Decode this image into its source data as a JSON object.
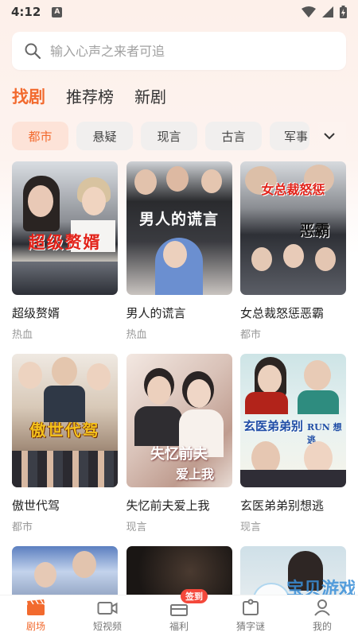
{
  "status_bar": {
    "time": "4:12",
    "sim_letter": "A"
  },
  "search": {
    "placeholder": "输入心声之来者可追"
  },
  "tabs": [
    {
      "label": "找剧",
      "active": true
    },
    {
      "label": "推荐榜",
      "active": false
    },
    {
      "label": "新剧",
      "active": false
    }
  ],
  "chips": [
    "都市",
    "悬疑",
    "现言",
    "古言",
    "军事"
  ],
  "chip_cut": "军事",
  "cards": [
    {
      "title": "超级赘婿",
      "tag": "热血",
      "poster_text": "超级赘婿"
    },
    {
      "title": "男人的谎言",
      "tag": "热血",
      "poster_text": "男人的谎言"
    },
    {
      "title": "女总裁怒惩恶霸",
      "tag": "都市",
      "poster_text": "女总裁怒惩",
      "poster_text2": "恶霸"
    },
    {
      "title": "傲世代驾",
      "tag": "都市",
      "poster_text": "傲世代驾"
    },
    {
      "title": "失忆前夫爱上我",
      "tag": "现言",
      "poster_text": "失忆前夫",
      "poster_text2": "爱上我"
    },
    {
      "title": "玄医弟弟别想逃",
      "tag": "现言",
      "poster_text": "玄医弟弟别",
      "poster_text2": "RUN 想逃"
    }
  ],
  "bottom_nav": [
    {
      "label": "剧场",
      "icon": "clapperboard-icon",
      "active": true
    },
    {
      "label": "短视频",
      "icon": "video-camera-icon",
      "active": false
    },
    {
      "label": "福利",
      "icon": "gift-box-icon",
      "active": false,
      "badge": "签到"
    },
    {
      "label": "猜字谜",
      "icon": "puzzle-icon",
      "active": false
    },
    {
      "label": "我的",
      "icon": "person-icon",
      "active": false
    }
  ],
  "watermark": {
    "text": "宝贝游戏网",
    "url": "baobeiy.com"
  },
  "colors": {
    "accent": "#f26a2e",
    "chip_bg": "#f1efee",
    "chip_active_bg": "#fde3d8",
    "badge": "#f4483b"
  }
}
